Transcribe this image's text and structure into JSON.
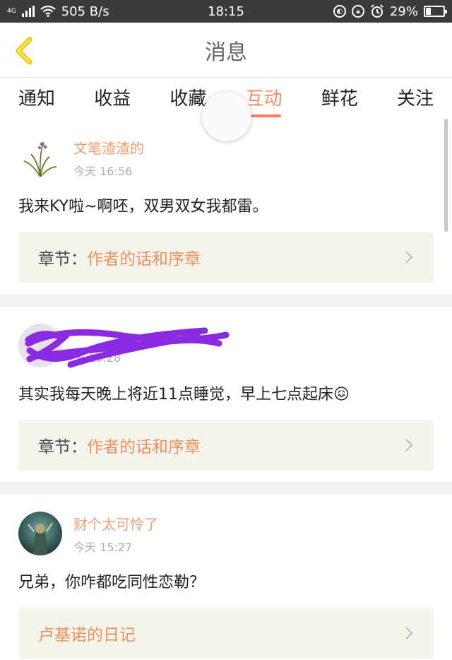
{
  "status_bar": {
    "network": "4G",
    "speed": "505 B/s",
    "time": "18:15",
    "battery": "29%",
    "battery_level": 0.29
  },
  "nav": {
    "title": "消息"
  },
  "tabs": [
    {
      "label": "通知"
    },
    {
      "label": "收益"
    },
    {
      "label": "收藏"
    },
    {
      "label": "互动",
      "active": true
    },
    {
      "label": "鲜花"
    },
    {
      "label": "关注"
    }
  ],
  "messages": [
    {
      "user": "文笔渣渣的",
      "time": "今天 16:56",
      "content": "我来KY啦~啊呸，双男双女我都雷。",
      "chapter_label": "章节：",
      "chapter_name": "作者的话和序章"
    },
    {
      "user": "",
      "time": "天 16:28",
      "content": "其实我每天晚上将近11点睡觉，早上七点起床😖",
      "chapter_label": "章节：",
      "chapter_name": "作者的话和序章"
    },
    {
      "user": "财个太可怜了",
      "time": "今天 15:27",
      "content": "兄弟，你咋都吃同性恋勒？",
      "chapter_label": "",
      "chapter_name": "卢基诺的日记"
    }
  ],
  "colors": {
    "accent": "#ff7b5c",
    "username": "#f0a070",
    "chapter_name": "#f0905a",
    "scribble": "#8a2be2"
  }
}
